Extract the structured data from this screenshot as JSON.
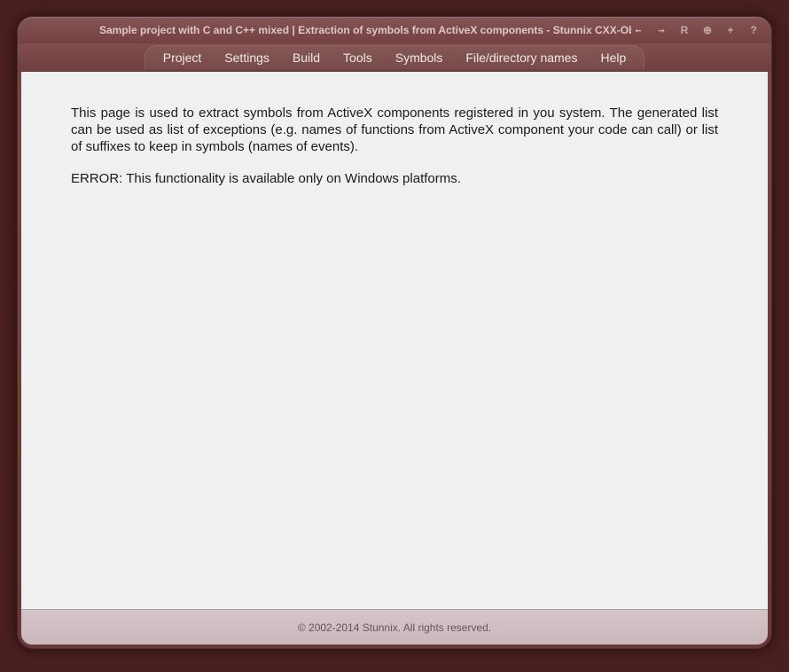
{
  "window": {
    "title": "Sample project with C and C++ mixed | Extraction of symbols from ActiveX components - Stunnix CXX-Obfus Pro"
  },
  "menu": {
    "items": [
      {
        "label": "Project"
      },
      {
        "label": "Settings"
      },
      {
        "label": "Build"
      },
      {
        "label": "Tools"
      },
      {
        "label": "Symbols"
      },
      {
        "label": "File/directory names"
      },
      {
        "label": "Help"
      }
    ]
  },
  "content": {
    "description": "This page is used to extract symbols from ActiveX components registered in you system. The generated list can be used as list of exceptions (e.g. names of functions from ActiveX component your code can call) or list of suffixes to keep in symbols (names of events).",
    "error": "ERROR: This functionality is available only on Windows platforms."
  },
  "footer": {
    "copyright": "© 2002-2014 Stunnix. All rights reserved."
  },
  "toolbar": {
    "back_icon": "←",
    "forward_icon": "→",
    "reload_label": "R",
    "add_label": "⊕",
    "plus_label": "+",
    "help_label": "?"
  }
}
